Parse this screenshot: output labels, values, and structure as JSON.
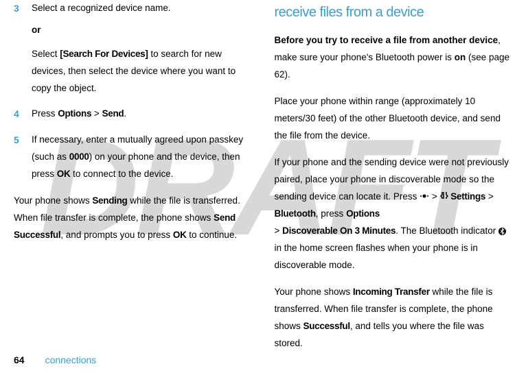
{
  "watermark": "DRAFT",
  "left": {
    "step3_num": "3",
    "step3_text": "Select a recognized device name.",
    "or": "or",
    "step3_sub_a": "Select ",
    "step3_sub_bold": "[Search For Devices]",
    "step3_sub_b": " to search for new devices, then select the device where you want to copy the object.",
    "step4_num": "4",
    "step4_a": "Press ",
    "step4_bold1": "Options",
    "step4_gt": " > ",
    "step4_bold2": "Send",
    "step4_b": ".",
    "step5_num": "5",
    "step5_a": "If necessary, enter a mutually agreed upon passkey (such as ",
    "step5_bold1": "0000",
    "step5_b": ") on your phone and the device, then press ",
    "step5_bold2": "OK",
    "step5_c": " to connect to the device.",
    "para_a": "Your phone shows ",
    "para_bold1": "Sending",
    "para_b": " while the file is transferred. When file transfer is complete, the phone shows ",
    "para_bold2": "Send Successful",
    "para_c": ", and prompts you to press ",
    "para_bold3": "OK",
    "para_d": " to continue."
  },
  "right": {
    "heading": "receive files from a device",
    "para1_a": "Before you try to receive a file from another device",
    "para1_b": ", make sure your phone's Bluetooth power is ",
    "para1_bold_on": "on",
    "para1_c": " (see page 62).",
    "para2": "Place your phone within range (approximately 10 meters/30 feet) of the other Bluetooth device, and send the file from the device.",
    "para3_a": "If your phone and the sending device were not previously paired, place your phone in discoverable mode so the sending device can locate it. Press ",
    "para3_gt1": " > ",
    "para3_bold_settings": "Settings",
    "para3_gt2": " > ",
    "para3_bold_bt": "Bluetooth",
    "para3_b": ", press ",
    "para3_bold_options": "Options",
    "para3_gt3": "> ",
    "para3_bold_disc": "Discoverable On 3 Minutes",
    "para3_c": ". The Bluetooth indicator ",
    "para3_d": " in the home screen flashes when your phone is in discoverable mode.",
    "para4_a": "Your phone shows ",
    "para4_bold1": "Incoming Transfer",
    "para4_b": " while the file is transferred. When file transfer is complete, the phone shows ",
    "para4_bold2": "Successful",
    "para4_c": ", and tells you where the file was stored."
  },
  "footer": {
    "page": "64",
    "label": "connections"
  },
  "icons": {
    "bt_glyph": "⁂"
  }
}
